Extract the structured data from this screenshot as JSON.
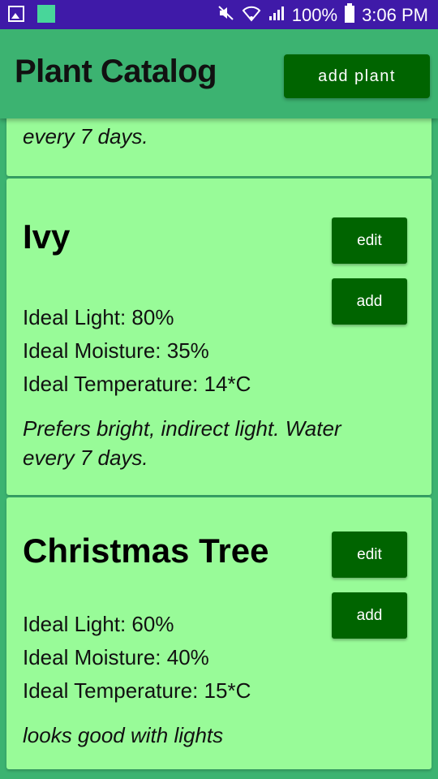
{
  "status_bar": {
    "battery": "100%",
    "time": "3:06 PM",
    "icons": [
      "image-icon",
      "app-square-icon",
      "mute-icon",
      "wifi-icon",
      "signal-icon",
      "battery-icon"
    ]
  },
  "app_bar": {
    "title": "Plant Catalog",
    "add_plant_label": "add plant"
  },
  "partial_card": {
    "note": "every 7 days."
  },
  "plants": [
    {
      "name": "Ivy",
      "light": "Ideal Light: 80%",
      "moisture": "Ideal Moisture: 35%",
      "temperature": "Ideal Temperature: 14*C",
      "note": "Prefers bright, indirect light. Water every 7 days.",
      "edit_label": "edit",
      "add_label": "add"
    },
    {
      "name": "Christmas Tree",
      "light": "Ideal Light: 60%",
      "moisture": "Ideal Moisture: 40%",
      "temperature": "Ideal Temperature: 15*C",
      "note": "looks good with lights",
      "edit_label": "edit",
      "add_label": "add"
    }
  ],
  "colors": {
    "status_bar": "#3f1aa8",
    "app_bar": "#3cb371",
    "card": "#98fb98",
    "button": "#006400"
  }
}
